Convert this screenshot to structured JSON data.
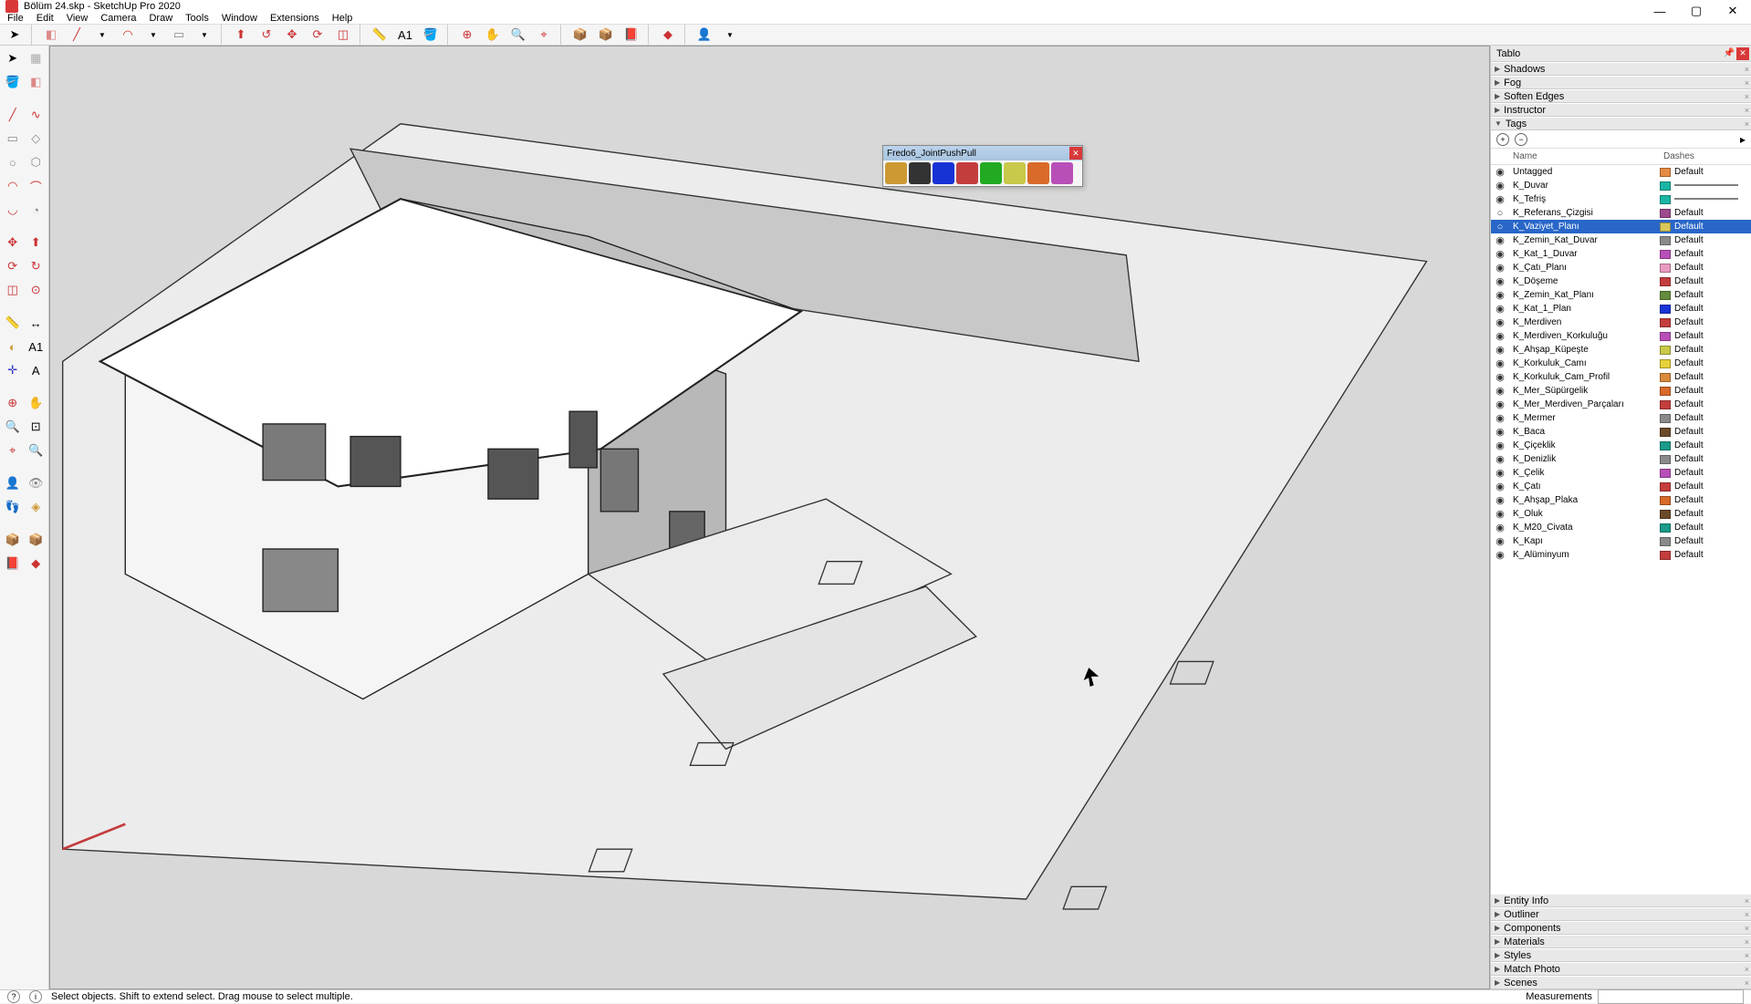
{
  "title": "Bölüm 24.skp - SketchUp Pro 2020",
  "menu": [
    "File",
    "Edit",
    "View",
    "Camera",
    "Draw",
    "Tools",
    "Window",
    "Extensions",
    "Help"
  ],
  "rightpanel": {
    "title": "Tablo",
    "sections_top": [
      "Shadows",
      "Fog",
      "Soften Edges",
      "Instructor",
      "Tags"
    ],
    "sections_bottom": [
      "Entity Info",
      "Outliner",
      "Components",
      "Materials",
      "Styles",
      "Match Photo",
      "Scenes"
    ],
    "tag_columns": {
      "name": "Name",
      "dashes": "Dashes"
    }
  },
  "floating": {
    "title": "Fredo6_JointPushPull"
  },
  "status": {
    "hint": "Select objects. Shift to extend select. Drag mouse to select multiple.",
    "meas_label": "Measurements"
  },
  "tags": [
    {
      "name": "Untagged",
      "color": "#e58b43",
      "dash": "Default",
      "vis": true
    },
    {
      "name": "K_Duvar",
      "color": "#1bb5a5",
      "dash": "line",
      "vis": true
    },
    {
      "name": "K_Tefriş",
      "color": "#1bb5a5",
      "dash": "line",
      "vis": true
    },
    {
      "name": "K_Referans_Çizgisi",
      "color": "#9e4a8e",
      "dash": "Default",
      "vis": false
    },
    {
      "name": "K_Vaziyet_Planı",
      "color": "#d8c85a",
      "dash": "Default",
      "vis": false,
      "selected": true
    },
    {
      "name": "K_Zemin_Kat_Duvar",
      "color": "#8a8a8a",
      "dash": "Default",
      "vis": true
    },
    {
      "name": "K_Kat_1_Duvar",
      "color": "#b84fb8",
      "dash": "Default",
      "vis": true
    },
    {
      "name": "K_Çatı_Planı",
      "color": "#e99bbf",
      "dash": "Default",
      "vis": true
    },
    {
      "name": "K_Döşeme",
      "color": "#c43d3d",
      "dash": "Default",
      "vis": true
    },
    {
      "name": "K_Zemin_Kat_Planı",
      "color": "#648b3d",
      "dash": "Default",
      "vis": true
    },
    {
      "name": "K_Kat_1_Plan",
      "color": "#1733d6",
      "dash": "Default",
      "vis": true
    },
    {
      "name": "K_Merdiven",
      "color": "#c43d3d",
      "dash": "Default",
      "vis": true
    },
    {
      "name": "K_Merdiven_Korkuluğu",
      "color": "#b84fb8",
      "dash": "Default",
      "vis": true
    },
    {
      "name": "K_Ahşap_Küpeşte",
      "color": "#c8c84a",
      "dash": "Default",
      "vis": true
    },
    {
      "name": "K_Korkuluk_Camı",
      "color": "#e8d23a",
      "dash": "Default",
      "vis": true
    },
    {
      "name": "K_Korkuluk_Cam_Profil",
      "color": "#d8893a",
      "dash": "Default",
      "vis": true
    },
    {
      "name": "K_Mer_Süpürgelik",
      "color": "#d86a2a",
      "dash": "Default",
      "vis": true
    },
    {
      "name": "K_Mer_Merdiven_Parçaları",
      "color": "#c43d3d",
      "dash": "Default",
      "vis": true
    },
    {
      "name": "K_Mermer",
      "color": "#8a8a8a",
      "dash": "Default",
      "vis": true
    },
    {
      "name": "K_Baca",
      "color": "#6b4a2a",
      "dash": "Default",
      "vis": true
    },
    {
      "name": "K_Çiçeklik",
      "color": "#1b9b8a",
      "dash": "Default",
      "vis": true
    },
    {
      "name": "K_Denizlik",
      "color": "#8a8a8a",
      "dash": "Default",
      "vis": true
    },
    {
      "name": "K_Çelik",
      "color": "#b84fb8",
      "dash": "Default",
      "vis": true
    },
    {
      "name": "K_Çatı",
      "color": "#c43d3d",
      "dash": "Default",
      "vis": true
    },
    {
      "name": "K_Ahşap_Plaka",
      "color": "#d86a2a",
      "dash": "Default",
      "vis": true
    },
    {
      "name": "K_Oluk",
      "color": "#6b4a2a",
      "dash": "Default",
      "vis": true
    },
    {
      "name": "K_M20_Civata",
      "color": "#1b9b8a",
      "dash": "Default",
      "vis": true
    },
    {
      "name": "K_Kapı",
      "color": "#8a8a8a",
      "dash": "Default",
      "vis": true
    },
    {
      "name": "K_Alüminyum",
      "color": "#c43d3d",
      "dash": "Default",
      "vis": true
    }
  ]
}
